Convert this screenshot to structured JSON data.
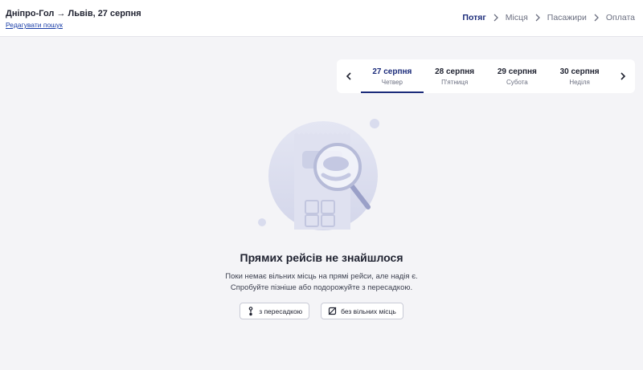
{
  "header": {
    "route": "Дніпро-Гол → Львів, 27 серпня",
    "edit_link": "Редагувати пошук",
    "steps": [
      {
        "label": "Потяг",
        "active": true
      },
      {
        "label": "Місця",
        "active": false
      },
      {
        "label": "Пасажири",
        "active": false
      },
      {
        "label": "Оплата",
        "active": false
      }
    ]
  },
  "dates": [
    {
      "date": "27 серпня",
      "weekday": "Четвер",
      "active": true
    },
    {
      "date": "28 серпня",
      "weekday": "П'ятниця",
      "active": false
    },
    {
      "date": "29 серпня",
      "weekday": "Субота",
      "active": false
    },
    {
      "date": "30 серпня",
      "weekday": "Неділя",
      "active": false
    }
  ],
  "empty_state": {
    "title": "Прямих рейсів не знайшлося",
    "line1": "Поки немає вільних місць на прямі рейси, але надія є.",
    "line2": "Спробуйте пізніше або подорожуйте з пересадкою.",
    "filters": [
      {
        "label": "з пересадкою",
        "icon": "transfer-icon"
      },
      {
        "label": "без вільних місць",
        "icon": "no-seats-icon"
      }
    ]
  },
  "colors": {
    "accent": "#1b2b7a",
    "link": "#1a3ea8",
    "background": "#f4f4f7",
    "illustration": "#c9cde6"
  }
}
